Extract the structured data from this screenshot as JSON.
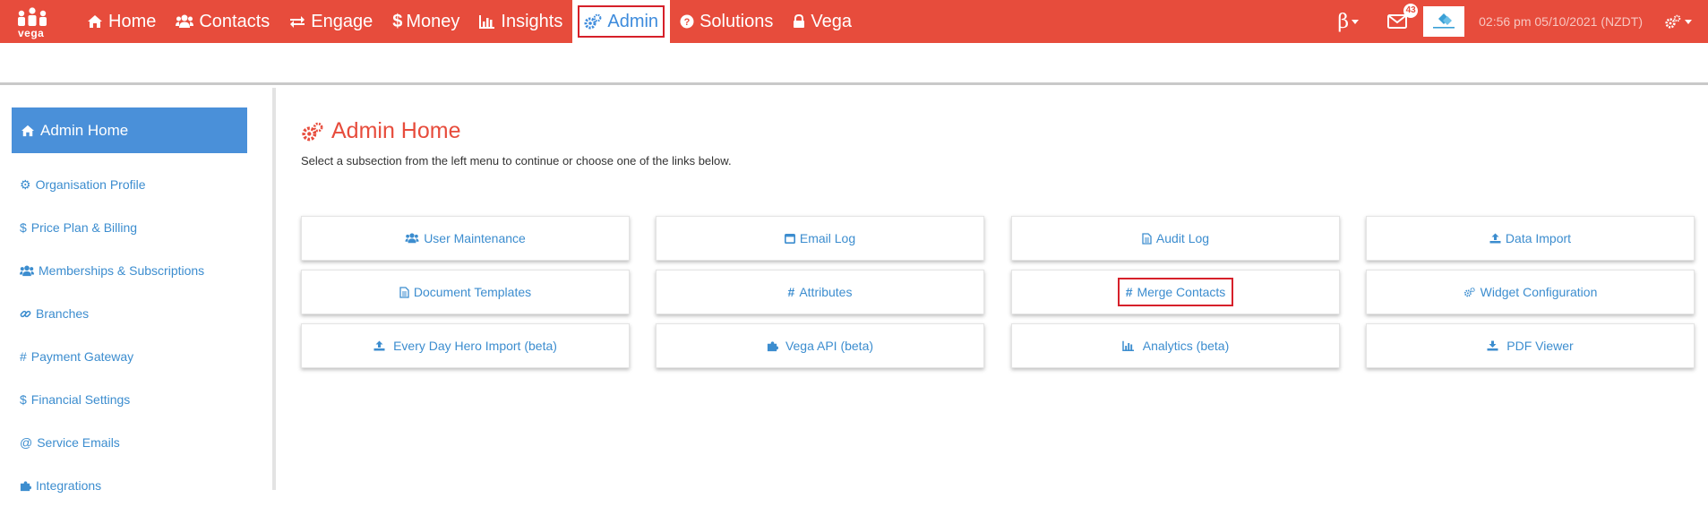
{
  "brand": {
    "logo_text": "vega"
  },
  "nav": {
    "items": [
      {
        "label": "Home",
        "icon": "home-icon"
      },
      {
        "label": "Contacts",
        "icon": "users-icon"
      },
      {
        "label": "Engage",
        "icon": "exchange-icon"
      },
      {
        "label": "Money",
        "icon": "dollar-icon"
      },
      {
        "label": "Insights",
        "icon": "bar-chart-icon"
      },
      {
        "label": "Admin",
        "icon": "cogs-icon",
        "active": true
      },
      {
        "label": "Solutions",
        "icon": "question-circle-icon"
      },
      {
        "label": "Vega",
        "icon": "lock-icon"
      }
    ]
  },
  "toolbar": {
    "beta_label": "β",
    "mail_count": "43",
    "datetime": "02:56 pm 05/10/2021 (NZDT)"
  },
  "sidebar": {
    "header": "Admin Home",
    "items": [
      {
        "label": "Organisation Profile",
        "icon": "gear-icon",
        "glyph": "⚙"
      },
      {
        "label": "Price Plan & Billing",
        "icon": "dollar-icon",
        "glyph": "$"
      },
      {
        "label": "Memberships & Subscriptions",
        "icon": "users-icon",
        "glyph": ""
      },
      {
        "label": "Branches",
        "icon": "link-icon",
        "glyph": ""
      },
      {
        "label": "Payment Gateway",
        "icon": "hash-icon",
        "glyph": "#"
      },
      {
        "label": "Financial Settings",
        "icon": "dollar-icon",
        "glyph": "$"
      },
      {
        "label": "Service Emails",
        "icon": "at-icon",
        "glyph": "@"
      },
      {
        "label": "Integrations",
        "icon": "puzzle-icon",
        "glyph": ""
      }
    ]
  },
  "main": {
    "title": "Admin Home",
    "subtitle": "Select a subsection from the left menu to continue or choose one of the links below.",
    "cards": [
      {
        "label": "User Maintenance",
        "icon": "users-icon"
      },
      {
        "label": "Email Log",
        "icon": "window-icon"
      },
      {
        "label": "Audit Log",
        "icon": "file-icon"
      },
      {
        "label": "Data Import",
        "icon": "upload-icon"
      },
      {
        "label": "Document Templates",
        "icon": "file-text-icon"
      },
      {
        "label": "Attributes",
        "icon": "hash-icon"
      },
      {
        "label": "Merge Contacts",
        "icon": "hash-icon",
        "highlighted": true
      },
      {
        "label": "Widget Configuration",
        "icon": "cogs-icon"
      },
      {
        "label": "Every Day Hero Import (beta)",
        "icon": "upload-icon"
      },
      {
        "label": "Vega API (beta)",
        "icon": "puzzle-icon"
      },
      {
        "label": "Analytics (beta)",
        "icon": "bar-chart-icon"
      },
      {
        "label": "PDF Viewer",
        "icon": "download-icon"
      }
    ]
  },
  "colors": {
    "nav_bg": "#e74c3c",
    "accent_blue": "#4a90d9",
    "link_blue": "#3c8dcf",
    "highlight_red": "#d6202a"
  }
}
